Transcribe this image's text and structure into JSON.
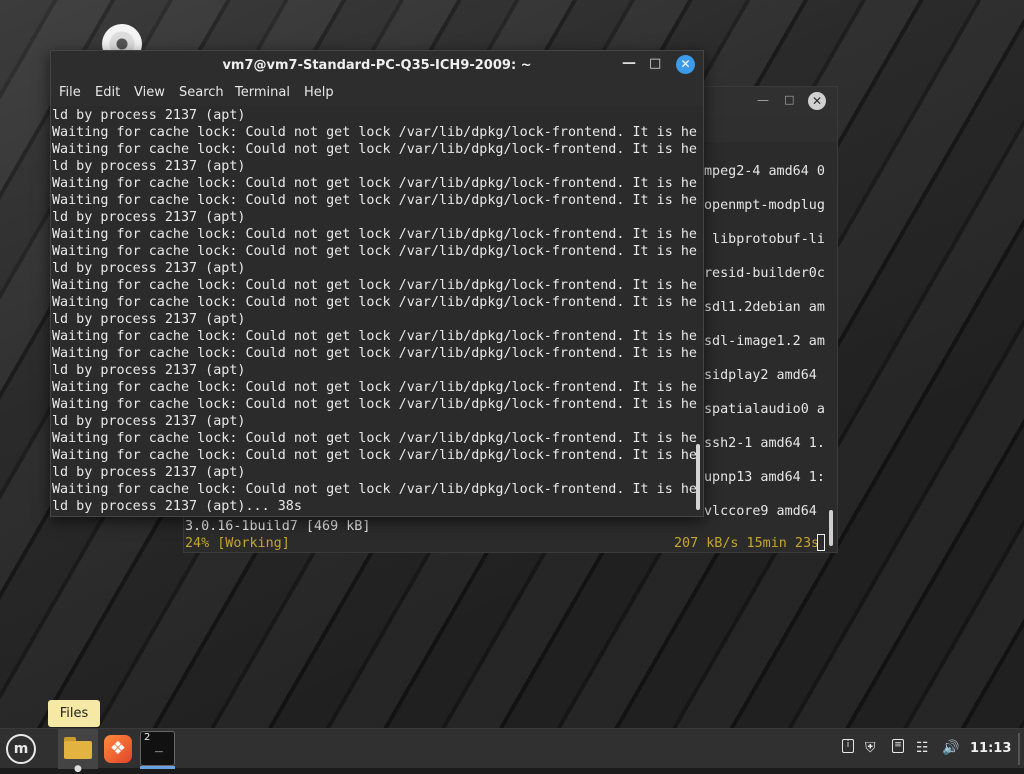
{
  "front_window": {
    "title": "vm7@vm7-Standard-PC-Q35-ICH9-2009: ~",
    "menu": [
      "File",
      "Edit",
      "View",
      "Search",
      "Terminal",
      "Help"
    ],
    "lines": [
      "ld by process 2137 (apt)",
      "Waiting for cache lock: Could not get lock /var/lib/dpkg/lock-frontend. It is he",
      "Waiting for cache lock: Could not get lock /var/lib/dpkg/lock-frontend. It is he",
      "ld by process 2137 (apt)",
      "Waiting for cache lock: Could not get lock /var/lib/dpkg/lock-frontend. It is he",
      "Waiting for cache lock: Could not get lock /var/lib/dpkg/lock-frontend. It is he",
      "ld by process 2137 (apt)",
      "Waiting for cache lock: Could not get lock /var/lib/dpkg/lock-frontend. It is he",
      "Waiting for cache lock: Could not get lock /var/lib/dpkg/lock-frontend. It is he",
      "ld by process 2137 (apt)",
      "Waiting for cache lock: Could not get lock /var/lib/dpkg/lock-frontend. It is he",
      "Waiting for cache lock: Could not get lock /var/lib/dpkg/lock-frontend. It is he",
      "ld by process 2137 (apt)",
      "Waiting for cache lock: Could not get lock /var/lib/dpkg/lock-frontend. It is he",
      "Waiting for cache lock: Could not get lock /var/lib/dpkg/lock-frontend. It is he",
      "ld by process 2137 (apt)",
      "Waiting for cache lock: Could not get lock /var/lib/dpkg/lock-frontend. It is he",
      "Waiting for cache lock: Could not get lock /var/lib/dpkg/lock-frontend. It is he",
      "ld by process 2137 (apt)",
      "Waiting for cache lock: Could not get lock /var/lib/dpkg/lock-frontend. It is he",
      "Waiting for cache lock: Could not get lock /var/lib/dpkg/lock-frontend. It is he",
      "ld by process 2137 (apt)",
      "Waiting for cache lock: Could not get lock /var/lib/dpkg/lock-frontend. It is he",
      "ld by process 2137 (apt)... 38s"
    ]
  },
  "back_window": {
    "visible_fragments": [
      "mpeg2-4 amd64 0",
      "openmpt-modplug",
      " libprotobuf-li",
      "resid-builder0c",
      "sdl1.2debian am",
      "sdl-image1.2 am",
      "sidplay2 amd64",
      "spatialaudio0 a",
      "ssh2-1 amd64 1.",
      "upnp13 amd64 1:",
      "vlccore9 amd64"
    ],
    "version_line": "3.0.16-1build7 [469 kB]",
    "status_left": "24% [Working]",
    "status_right": "207 kB/s 15min 23s"
  },
  "tooltip": "Files",
  "taskbar": {
    "terminal_badge": "2",
    "clock": "11:13",
    "icons": [
      "menu-icon",
      "folder-icon",
      "firefox-icon",
      "terminal-icon",
      "update-manager-icon",
      "shield-icon",
      "clipboard-icon",
      "network-icon",
      "volume-icon"
    ]
  },
  "colors": {
    "terminal_bg": "#2b2b2b",
    "status_yellow": "#c5a52e",
    "close_button_blue": "#3d9be9",
    "tooltip_bg": "#f6e9a6",
    "taskbar_bg": "#303030"
  }
}
